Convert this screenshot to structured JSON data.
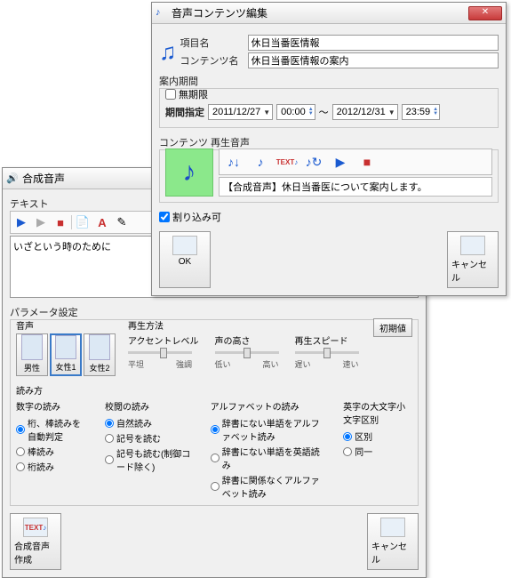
{
  "front": {
    "title": "音声コンテンツ編集",
    "item_label": "項目名",
    "item_value": "休日当番医情報",
    "content_label": "コンテンツ名",
    "content_value": "休日当番医情報の案内",
    "period_section": "案内期間",
    "unlimited": "無期限",
    "period_spec": "期間指定",
    "date_from": "2011/12/27",
    "time_from": "00:00",
    "tilde": "～",
    "date_to": "2012/12/31",
    "time_to": "23:59",
    "audio_section": "コンテンツ 再生音声",
    "text_badge": "TEXT",
    "audio_text": "【合成音声】休日当番医について案内します。",
    "interrupt": "割り込み可",
    "ok": "OK",
    "cancel": "キャンセル"
  },
  "back": {
    "title": "合成音声",
    "text_section": "テキスト",
    "text_content": "いざという時のために",
    "param_section": "パラメータ設定",
    "voice_label": "音声",
    "voices": [
      "男性",
      "女性1",
      "女性2"
    ],
    "playback_label": "再生方法",
    "sliders": [
      {
        "title": "アクセントレベル",
        "left": "平坦",
        "right": "強調",
        "pos": 36
      },
      {
        "title": "声の高さ",
        "left": "低い",
        "right": "高い",
        "pos": 32
      },
      {
        "title": "再生スピード",
        "left": "遅い",
        "right": "速い",
        "pos": 32
      }
    ],
    "reset": "初期値",
    "read_label": "読み方",
    "groups": [
      {
        "title": "数字の読み",
        "opts": [
          "桁、棒読みを自動判定",
          "棒読み",
          "桁読み"
        ],
        "sel": 0
      },
      {
        "title": "校閲の読み",
        "opts": [
          "自然読み",
          "記号を読む",
          "記号も読む(制御コード除く)"
        ],
        "sel": 0
      },
      {
        "title": "アルファベットの読み",
        "opts": [
          "辞書にない単語をアルファベット読み",
          "辞書にない単語を英語読み",
          "辞書に関係なくアルファベット読み"
        ],
        "sel": 0
      },
      {
        "title": "英字の大文字小文字区別",
        "opts": [
          "区別",
          "同一"
        ],
        "sel": 0
      }
    ],
    "create": "合成音声作成",
    "create_badge": "TEXT",
    "cancel": "キャンセル"
  }
}
